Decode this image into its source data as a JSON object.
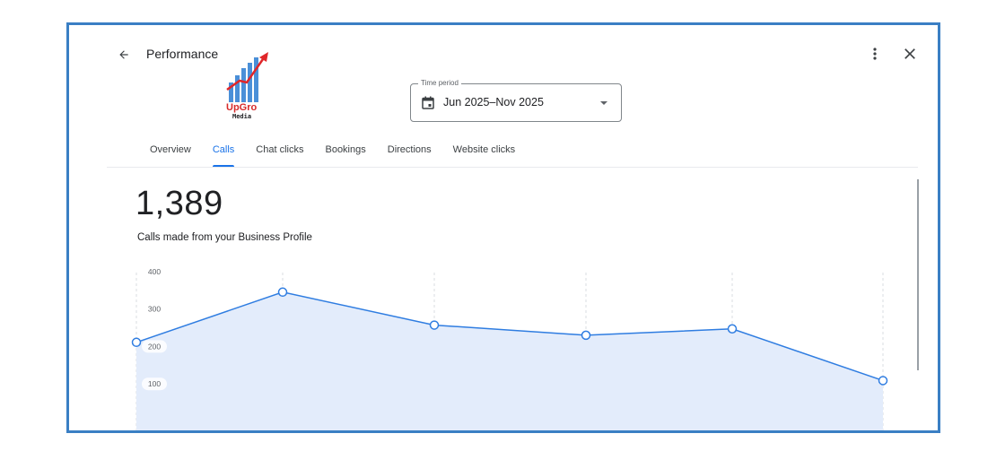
{
  "header": {
    "title": "Performance"
  },
  "logo": {
    "text_top": "UpGro",
    "text_bottom": "Media"
  },
  "time_period": {
    "label": "Time period",
    "value": "Jun 2025–Nov 2025"
  },
  "tabs": [
    {
      "label": "Overview",
      "active": false
    },
    {
      "label": "Calls",
      "active": true
    },
    {
      "label": "Chat clicks",
      "active": false
    },
    {
      "label": "Bookings",
      "active": false
    },
    {
      "label": "Directions",
      "active": false
    },
    {
      "label": "Website clicks",
      "active": false
    }
  ],
  "metric": {
    "value": "1,389",
    "caption": "Calls made from your Business Profile"
  },
  "colors": {
    "accent": "#1a73e8",
    "line": "#2f7de1",
    "area": "#e3ecfb",
    "frame_border": "#3a7fc4"
  },
  "icons": {
    "back": "arrow-back-icon",
    "more": "more-vert-icon",
    "close": "close-icon",
    "calendar": "calendar-icon",
    "dropdown": "caret-down-icon"
  },
  "chart_data": {
    "type": "area",
    "title": "",
    "xlabel": "",
    "ylabel": "",
    "ylim": [
      0,
      400
    ],
    "yticks": [
      100,
      200,
      300,
      400
    ],
    "grid": "vertical dashed",
    "series": [
      {
        "values": [
          211,
          345,
          257,
          230,
          247,
          109
        ]
      }
    ]
  }
}
